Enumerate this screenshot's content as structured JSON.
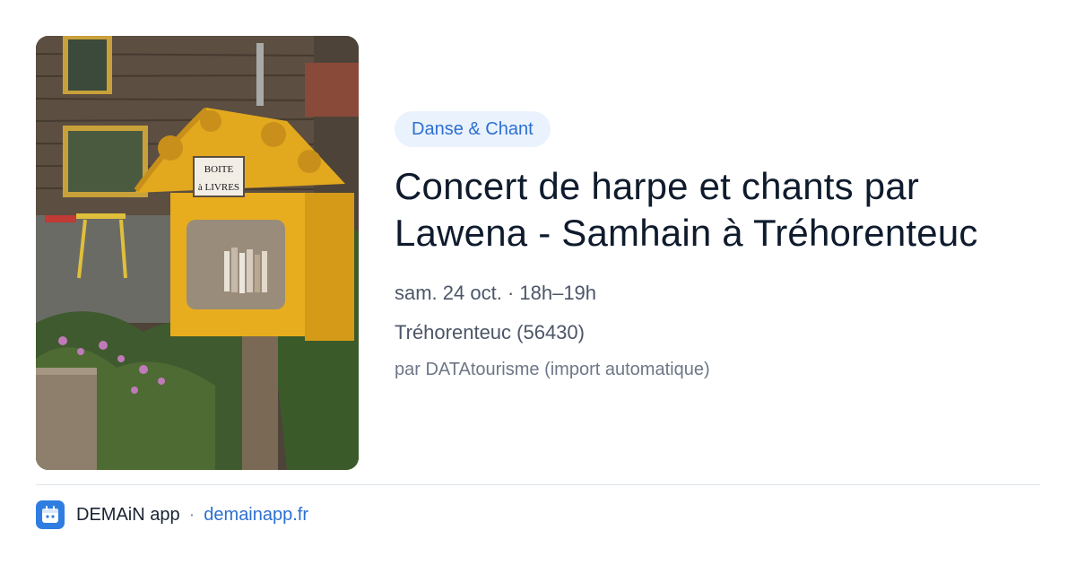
{
  "event": {
    "category": "Danse & Chant",
    "title": "Concert de harpe et chants par Lawena - Samhain à Tréhorenteuc",
    "datetime": "sam. 24 oct. · 18h–19h",
    "location": "Tréhorenteuc (56430)",
    "source": "par DATAtourisme (import automatique)",
    "photo": {
      "sign_line1": "BOITE",
      "sign_line2": "à LIVRES"
    }
  },
  "footer": {
    "app_name": "DEMAiN app",
    "separator": "·",
    "url": "demainapp.fr"
  },
  "colors": {
    "accent": "#2c6fd1",
    "category_bg": "#eaf2fd",
    "logo_bg": "#2f7de1"
  }
}
